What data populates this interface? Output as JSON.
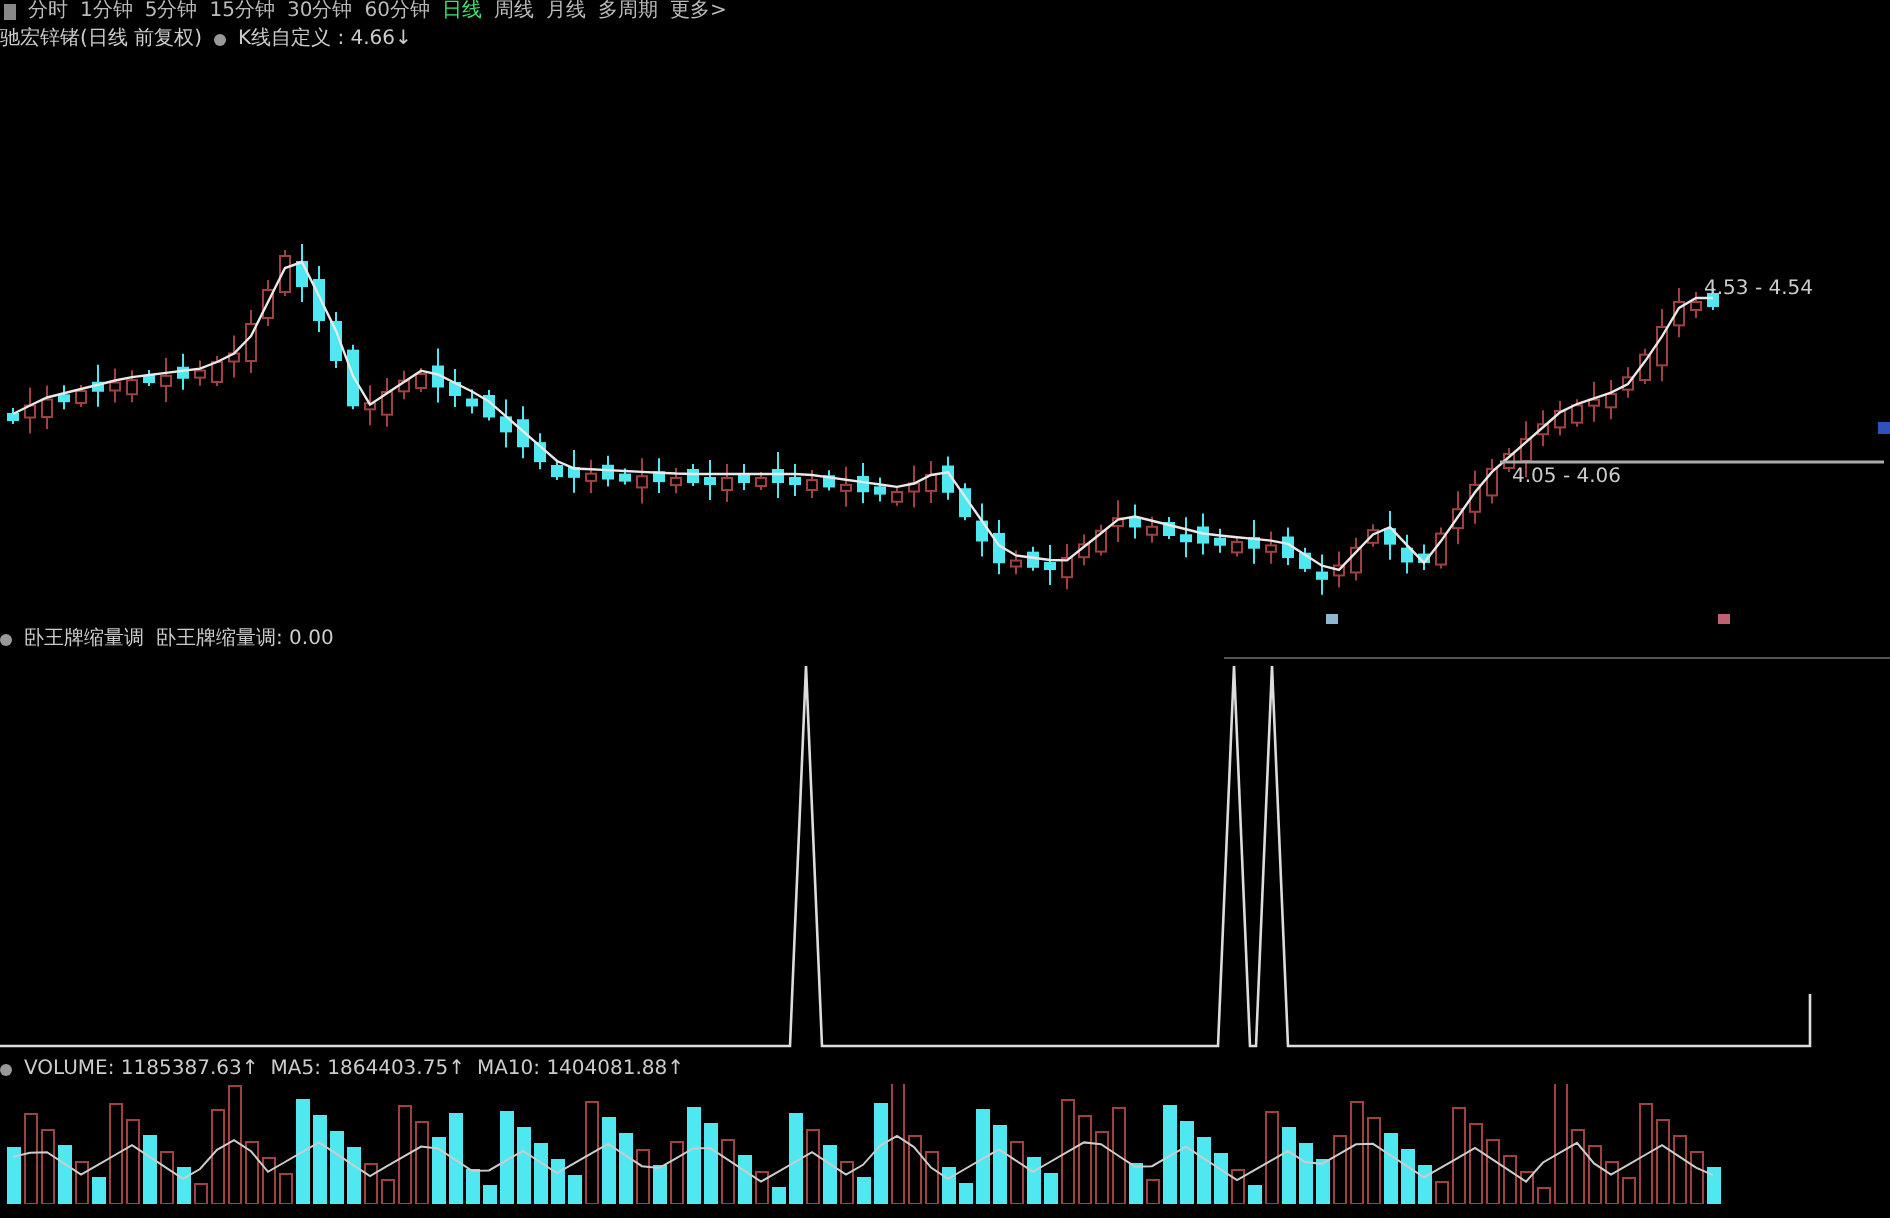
{
  "period_tabs": [
    {
      "label": "分时",
      "selected": false
    },
    {
      "label": "1分钟",
      "selected": false
    },
    {
      "label": "5分钟",
      "selected": false
    },
    {
      "label": "15分钟",
      "selected": false
    },
    {
      "label": "30分钟",
      "selected": false
    },
    {
      "label": "60分钟",
      "selected": false
    },
    {
      "label": "日线",
      "selected": true
    },
    {
      "label": "周线",
      "selected": false
    },
    {
      "label": "月线",
      "selected": false
    },
    {
      "label": "多周期",
      "selected": false
    },
    {
      "label": "更多>",
      "selected": false
    }
  ],
  "chart_title": "驰宏锌锗(日线 前复权)",
  "price_indicator": {
    "name": "K线自定义 :",
    "value": "4.66↓"
  },
  "price_labels": [
    {
      "text": "4.53 - 4.54"
    },
    {
      "text": "4.05 - 4.06"
    }
  ],
  "oscillator": {
    "title": "卧王牌缩量调",
    "label": "卧王牌缩量调:",
    "value": "0.00"
  },
  "volume_stats": [
    {
      "label": "VOLUME:",
      "value": "1185387.63↑"
    },
    {
      "label": "MA5:",
      "value": "1864403.75↑"
    },
    {
      "label": "MA10:",
      "value": "1404081.88↑"
    }
  ]
}
